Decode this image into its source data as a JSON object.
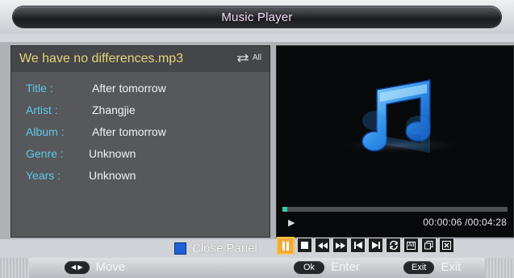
{
  "window": {
    "title": "Music Player"
  },
  "track": {
    "file_name": "We have no differences.mp3",
    "repeat_mode": "All",
    "fields": [
      {
        "key": "Title :",
        "value": "After tomorrow"
      },
      {
        "key": "Artist :",
        "value": "Zhangjie"
      },
      {
        "key": "Album :",
        "value": "After tomorrow"
      },
      {
        "key": "Genre :",
        "value": "Unknown"
      },
      {
        "key": "Years :",
        "value": "Unknown"
      }
    ]
  },
  "playback": {
    "time_display": "00:00:06 /00:04:28",
    "progress_fraction": 0.022
  },
  "controls": {
    "close_panel_label": "Close Panel",
    "buttons": [
      "pause-icon",
      "stop-icon",
      "rewind-icon",
      "fast-forward-icon",
      "previous-icon",
      "next-icon",
      "repeat-icon",
      "repeat-all-icon",
      "copy-icon",
      "close-icon"
    ],
    "repeat_all_text": "All"
  },
  "footer": {
    "move_label": "Move",
    "enter_key": "Ok",
    "enter_label": "Enter",
    "exit_key": "Exit",
    "exit_label": "Exit"
  },
  "colors": {
    "accent_yellow": "#e5d47a",
    "label_cyan": "#5ec8ea",
    "active_button": "#f2a93b",
    "progress": "#35c9a8"
  }
}
